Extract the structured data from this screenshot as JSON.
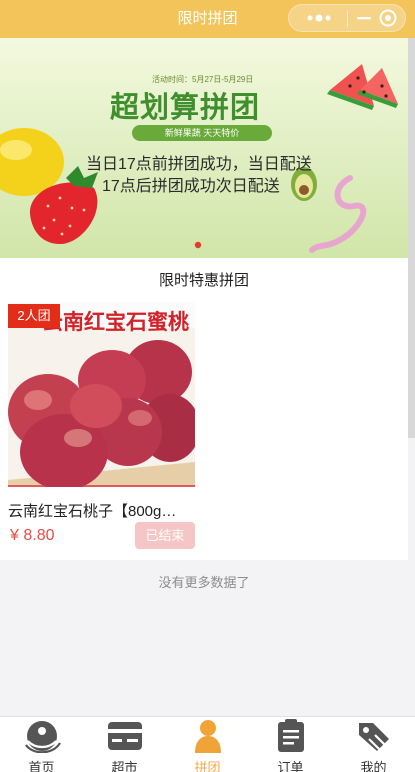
{
  "window": {
    "title": "限时拼团"
  },
  "banner": {
    "activity_time": "活动时间：5月27日-5月29日",
    "headline": "超划算拼团",
    "tagline": "新鲜果蔬 天天特价",
    "line1": "当日17点前拼团成功，当日配送",
    "line2": "17点后拼团成功次日配送",
    "carousel": {
      "count": 1,
      "active": 1
    }
  },
  "section": {
    "title": "限时特惠拼团"
  },
  "products": [
    {
      "group_tag": "2人团",
      "image_caption": "云南红宝石蜜桃",
      "name": "云南红宝石桃子【800g…",
      "price": "¥ 8.80",
      "status": "已结束"
    }
  ],
  "footer": {
    "no_more": "没有更多数据了"
  },
  "tabbar": {
    "items": [
      {
        "label": "首页",
        "icon": "home-icon",
        "active": false
      },
      {
        "label": "超市",
        "icon": "market-icon",
        "active": false
      },
      {
        "label": "拼团",
        "icon": "group-icon",
        "active": true
      },
      {
        "label": "订单",
        "icon": "order-icon",
        "active": false
      },
      {
        "label": "我的",
        "icon": "user-icon",
        "active": false
      }
    ],
    "active_color": "#f0ad4e",
    "inactive_color": "#555555"
  },
  "colors": {
    "navbar": "#f2c45a",
    "price": "#ee4a43",
    "tag": "#e42d19",
    "status_badge": "#f6c6c6"
  }
}
